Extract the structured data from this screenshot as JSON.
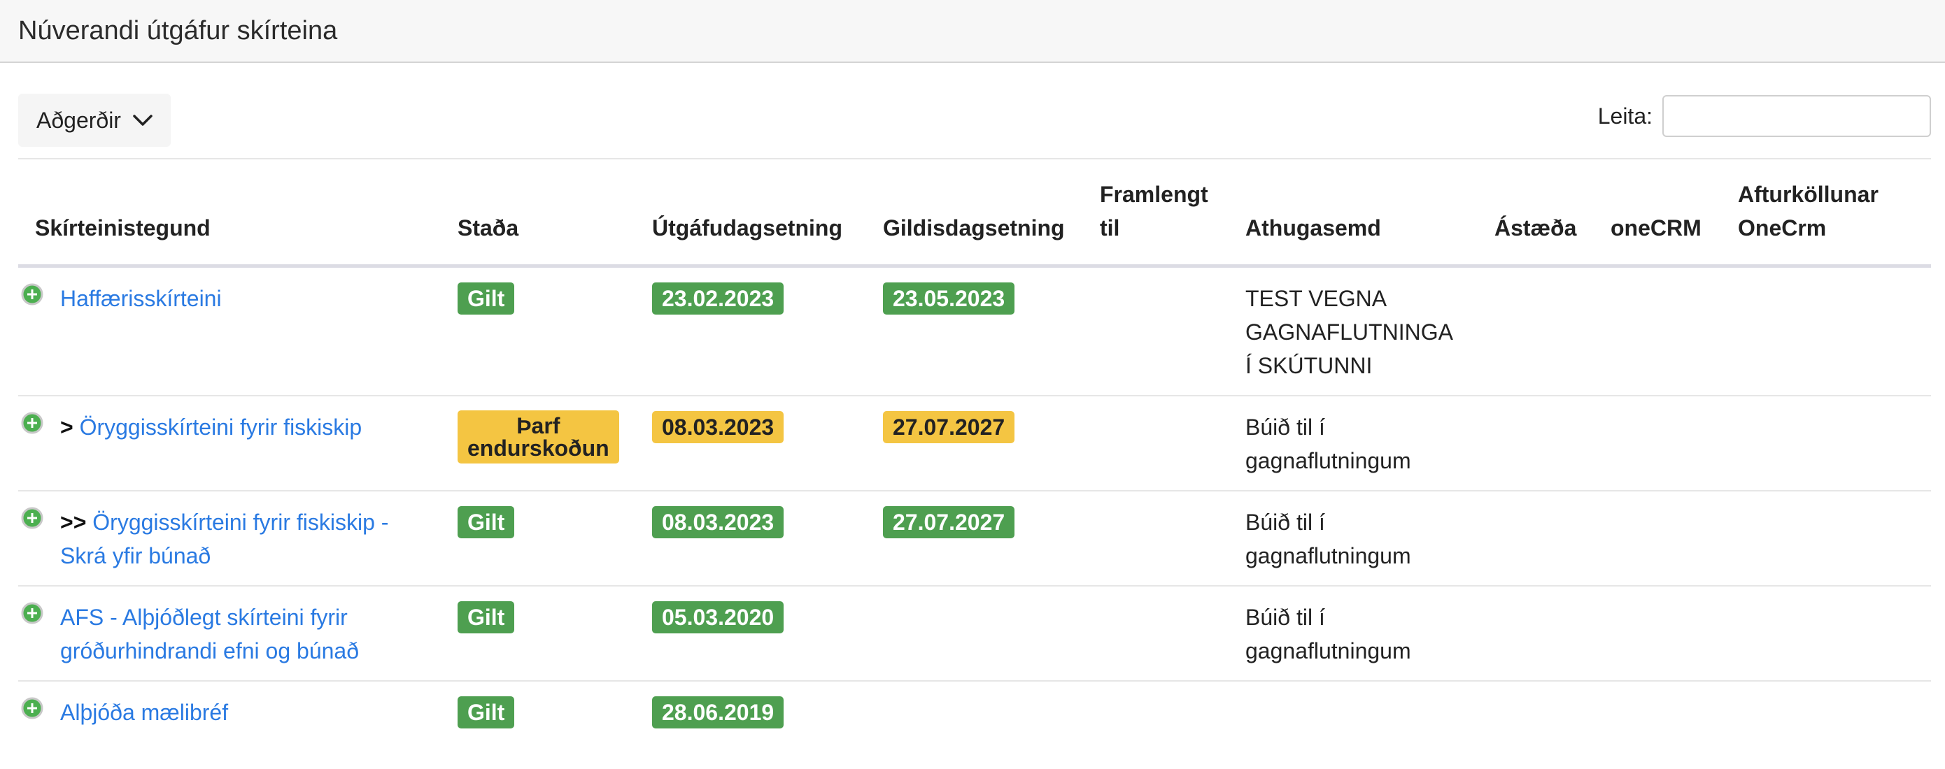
{
  "page": {
    "title": "Núverandi útgáfur skírteina"
  },
  "toolbar": {
    "actions_label": "Aðgerðir",
    "search_label": "Leita:",
    "search_value": ""
  },
  "table": {
    "columns": {
      "type": "Skírteinistegund",
      "status": "Staða",
      "issue_date": "Útgáfudagsetning",
      "valid_date": "Gildisdagsetning",
      "extended_l1": "Framlengt",
      "extended_l2": "til",
      "remark": "Athugasemd",
      "reason": "Ástæða",
      "onecrm": "oneCRM",
      "revoke_l1": "Afturköllunar",
      "revoke_l2": "OneCrm"
    },
    "rows": [
      {
        "prefix": "",
        "name": "Haffærisskírteini",
        "status": "Gilt",
        "issue_date": "23.02.2023",
        "valid_date": "23.05.2023",
        "remark": "TEST VEGNA GAGNAFLUTNINGA Í SKÚTUNNI"
      },
      {
        "prefix": "> ",
        "name": "Öryggisskírteini fyrir fiskiskip",
        "status_l1": "Þarf",
        "status_l2": "endurskoðun",
        "issue_date": "08.03.2023",
        "valid_date": "27.07.2027",
        "remark": "Búið til í gagnaflutningum"
      },
      {
        "prefix": ">> ",
        "name": "Öryggisskírteini fyrir fiskiskip - Skrá yfir búnað",
        "status": "Gilt",
        "issue_date": "08.03.2023",
        "valid_date": "27.07.2027",
        "remark": "Búið til í gagnaflutningum"
      },
      {
        "prefix": "",
        "name": "AFS - Alþjóðlegt skírteini fyrir gróðurhindrandi efni og búnað",
        "status": "Gilt",
        "issue_date": "05.03.2020",
        "remark": "Búið til í gagnaflutningum"
      },
      {
        "prefix": "",
        "name": "Alþjóða mælibréf",
        "status": "Gilt",
        "issue_date": "28.06.2019"
      }
    ]
  },
  "colors": {
    "link": "#2a7ae2",
    "badge_green": "#4e9f50",
    "badge_yellow": "#f4c542",
    "expand_icon": "#4caf50"
  },
  "icons": {
    "expand": "plus-circle-icon",
    "dropdown": "chevron-down-icon"
  }
}
